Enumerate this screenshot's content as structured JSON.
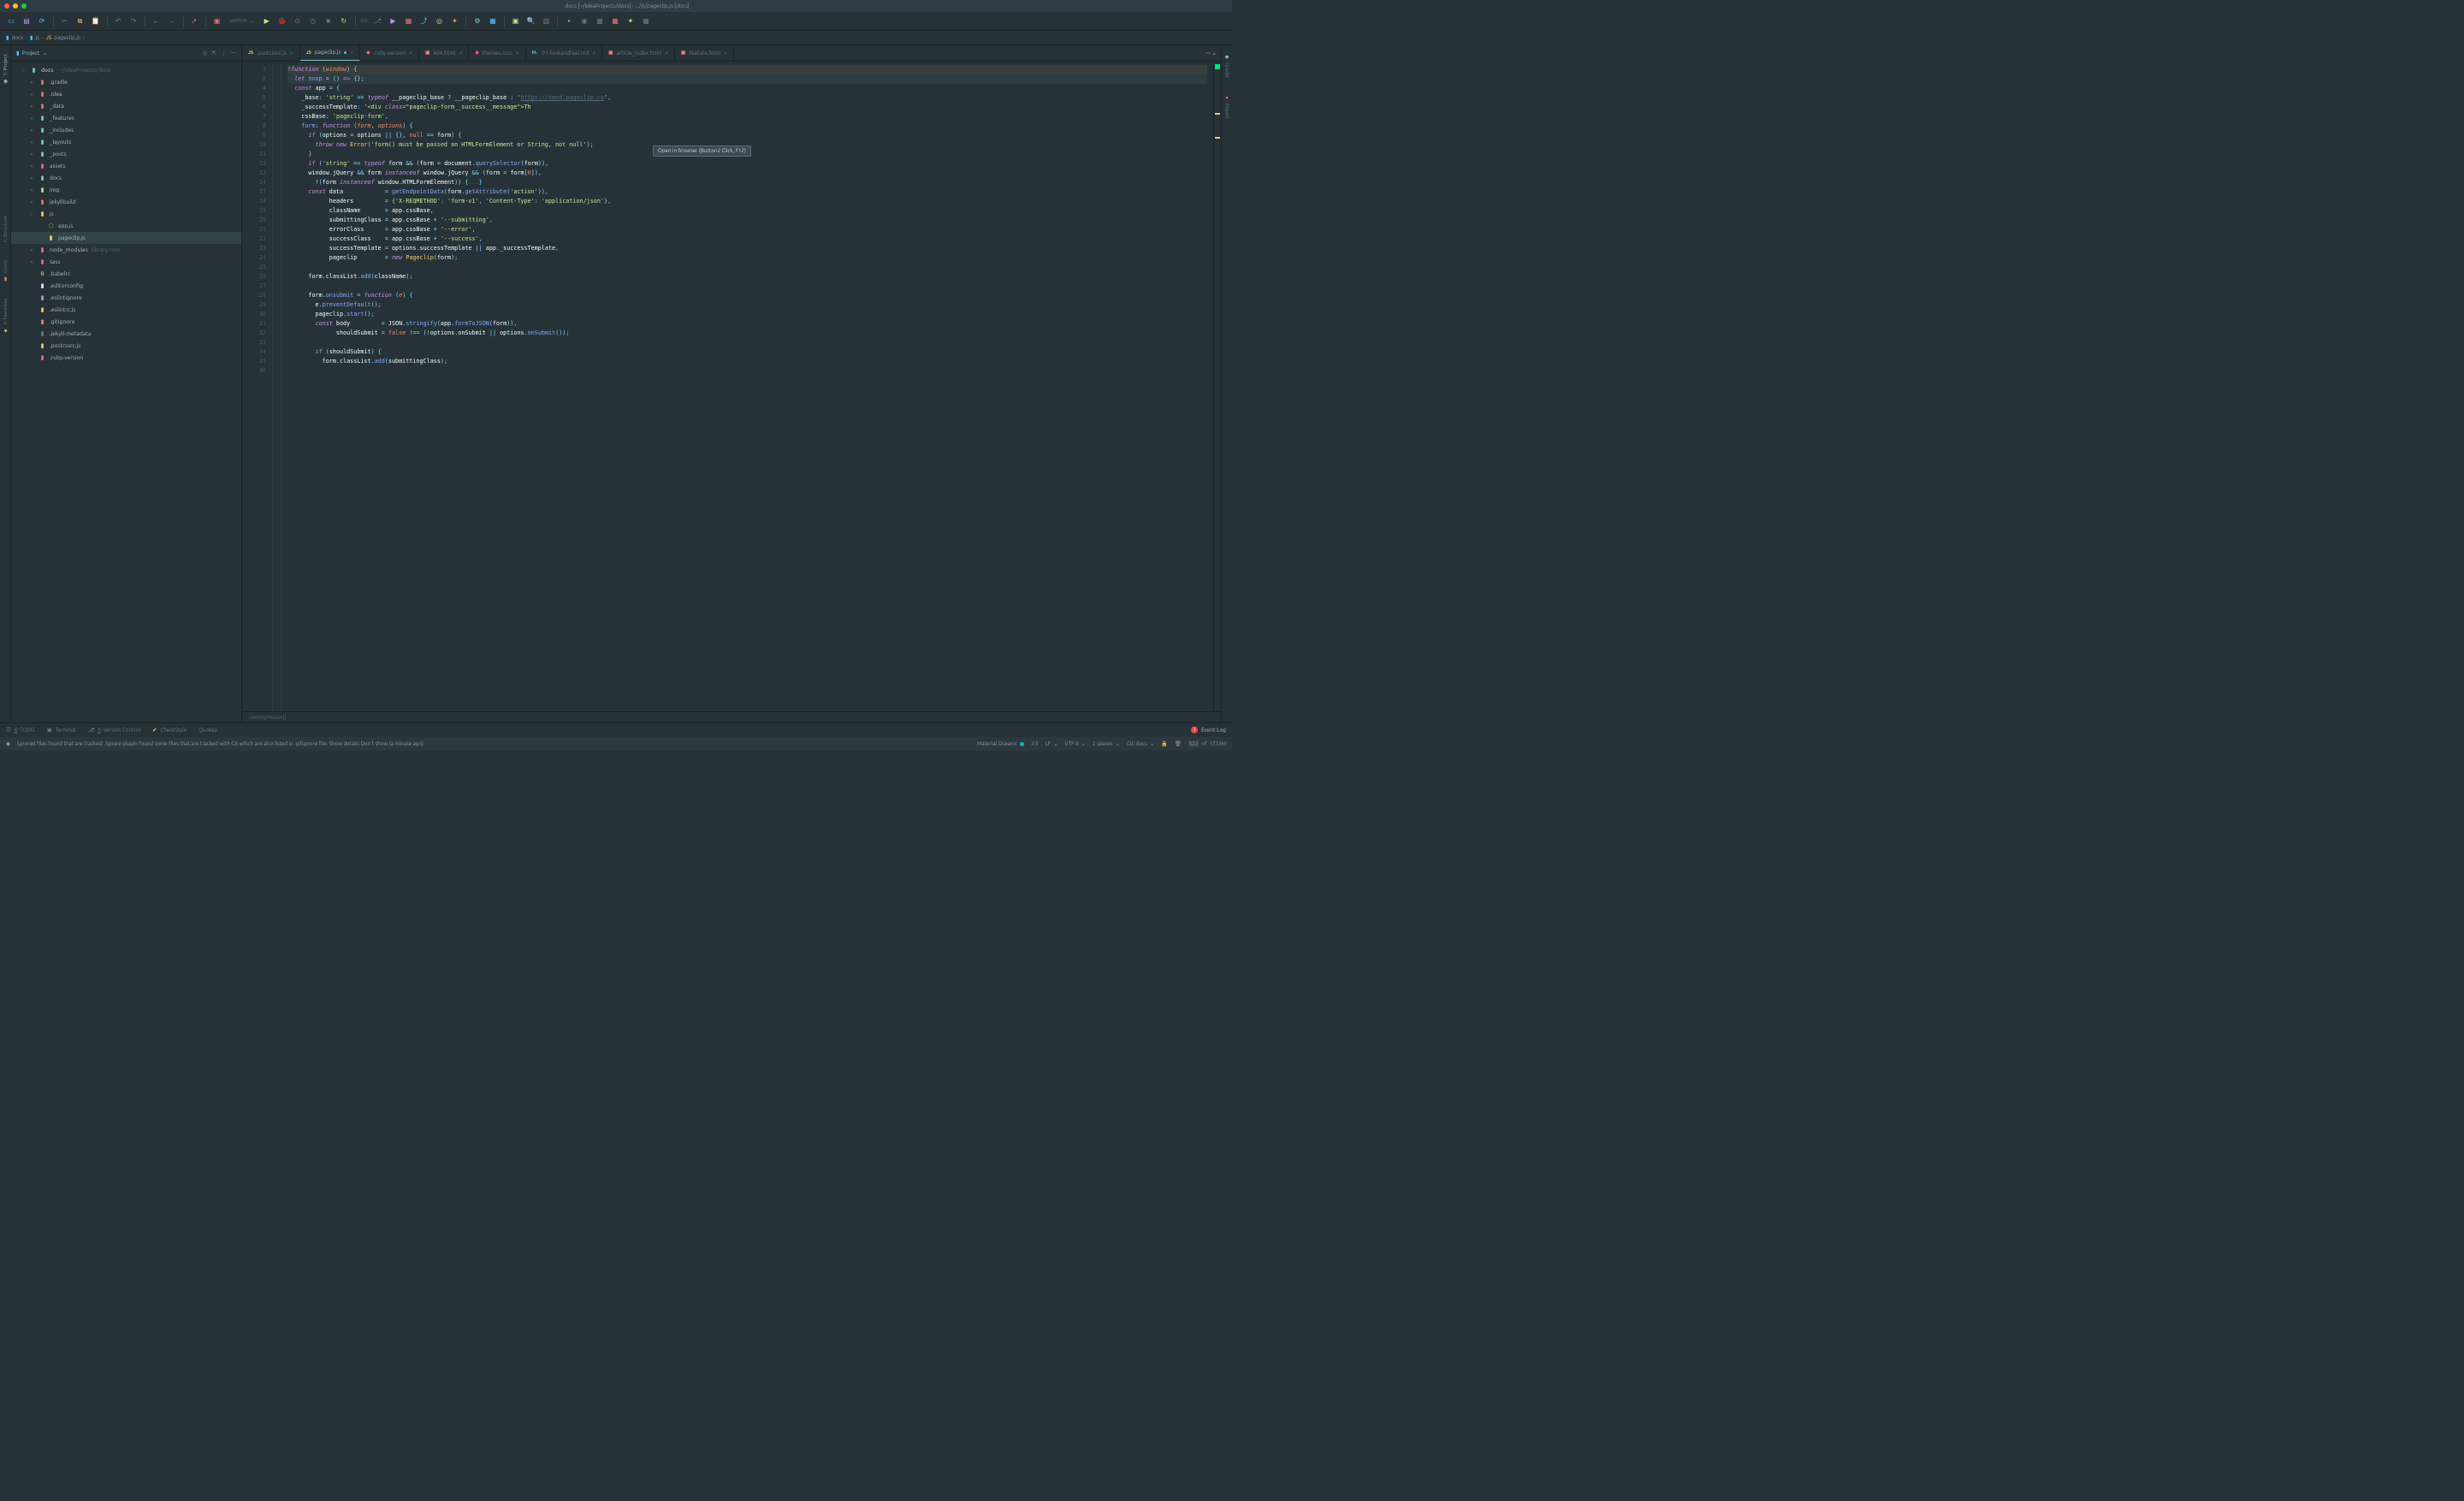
{
  "title": "docs [~/IdeaProjects/docs] - .../js/pageclip.js [docs]",
  "toolbar": {
    "watch_label": "WATCH",
    "git_label": "Git:"
  },
  "breadcrumbs": [
    {
      "icon": "folder",
      "label": "docs"
    },
    {
      "icon": "folder",
      "label": "js"
    },
    {
      "icon": "js",
      "label": "pageclip.js"
    }
  ],
  "sidebar": {
    "view_label": "Project",
    "root": {
      "label": "docs",
      "path": "~/IdeaProjects/docs"
    },
    "items": [
      {
        "depth": 1,
        "kind": "folder",
        "label": ".gradle",
        "cls": "folder-special",
        "expandable": true
      },
      {
        "depth": 1,
        "kind": "folder",
        "label": ".idea",
        "cls": "folder-special",
        "expandable": true
      },
      {
        "depth": 1,
        "kind": "folder",
        "label": "_data",
        "cls": "folder-special",
        "expandable": true
      },
      {
        "depth": 1,
        "kind": "folder",
        "label": "_features",
        "cls": "folder",
        "expandable": true
      },
      {
        "depth": 1,
        "kind": "folder",
        "label": "_includes",
        "cls": "folder",
        "expandable": true
      },
      {
        "depth": 1,
        "kind": "folder",
        "label": "_layouts",
        "cls": "folder",
        "expandable": true
      },
      {
        "depth": 1,
        "kind": "folder",
        "label": "_posts",
        "cls": "folder",
        "expandable": true
      },
      {
        "depth": 1,
        "kind": "folder",
        "label": "assets",
        "cls": "folder-special",
        "expandable": true
      },
      {
        "depth": 1,
        "kind": "folder",
        "label": "docs",
        "cls": "folder",
        "expandable": true
      },
      {
        "depth": 1,
        "kind": "folder",
        "label": "img",
        "cls": "folder-green",
        "expandable": true
      },
      {
        "depth": 1,
        "kind": "folder",
        "label": "jekyllbuild",
        "cls": "folder-special",
        "expandable": true,
        "selected": false
      },
      {
        "depth": 1,
        "kind": "folder",
        "label": "js",
        "cls": "fic-js",
        "expandable": true,
        "open": true
      },
      {
        "depth": 2,
        "kind": "file",
        "label": "app.js",
        "cls": "fic-node"
      },
      {
        "depth": 2,
        "kind": "file",
        "label": "pageclip.js",
        "cls": "fic-js",
        "selected": true
      },
      {
        "depth": 1,
        "kind": "folder",
        "label": "node_modules",
        "cls": "folder-nm",
        "suffix": "library root",
        "expandable": true
      },
      {
        "depth": 1,
        "kind": "folder",
        "label": "sass",
        "cls": "fic-sass",
        "expandable": true
      },
      {
        "depth": 1,
        "kind": "file",
        "label": ".babelrc",
        "cls": "fic-babel"
      },
      {
        "depth": 1,
        "kind": "file",
        "label": ".editorconfig",
        "cls": "fic-editor"
      },
      {
        "depth": 1,
        "kind": "file",
        "label": ".eslintignore",
        "cls": "fic-eslint"
      },
      {
        "depth": 1,
        "kind": "file",
        "label": ".eslintrc.js",
        "cls": "fic-js"
      },
      {
        "depth": 1,
        "kind": "file",
        "label": ".gitignore",
        "cls": "fic-git"
      },
      {
        "depth": 1,
        "kind": "file",
        "label": ".jekyll-metadata",
        "cls": "fic-generic"
      },
      {
        "depth": 1,
        "kind": "file",
        "label": ".postcssrc.js",
        "cls": "fic-js"
      },
      {
        "depth": 1,
        "kind": "file",
        "label": ".ruby-version",
        "cls": "fic-ruby"
      }
    ]
  },
  "left_vtabs": [
    {
      "label": "1: Project",
      "active": true
    },
    {
      "label": "7: Structure"
    },
    {
      "label": "Grunt"
    },
    {
      "label": "2: Favorites"
    }
  ],
  "right_vtabs": [
    {
      "label": "Gradle"
    },
    {
      "label": "Maven"
    }
  ],
  "tabs": [
    {
      "icon": "js",
      "label": ".postcssrc.js",
      "active": false
    },
    {
      "icon": "js",
      "label": "pageclip.js",
      "active": true,
      "modified": true
    },
    {
      "icon": "ruby",
      "label": ".ruby-version"
    },
    {
      "icon": "html",
      "label": "404.html"
    },
    {
      "icon": "sass",
      "label": "themes.scss"
    },
    {
      "icon": "md",
      "label": "01-lookandfeel.md"
    },
    {
      "icon": "html",
      "label": "article_index.html"
    },
    {
      "icon": "html",
      "label": "feature.html"
    }
  ],
  "tabs_more": "⋯",
  "code": {
    "lines_start": 1,
    "tooltip": "Open in browser (Button2 Click, F12)",
    "anon_crumb": "<anonymous>()",
    "url": "https://send.pageclip.co"
  },
  "bottom_tabs": [
    {
      "icon": "☰",
      "label": "6: TODO",
      "under": "6"
    },
    {
      "icon": "▣",
      "label": "Terminal"
    },
    {
      "icon": "⎇",
      "label": "9: Version Control",
      "under": "9"
    },
    {
      "icon": "✔",
      "label": "CheckStyle"
    },
    {
      "icon": "",
      "label": "Quokka"
    }
  ],
  "event_log": {
    "count": "3",
    "label": "Event Log"
  },
  "status": {
    "msg_prefix": "Ignored files found that are tracked: .ignore plugin found some files that are tracked with Git which are also listed in .gitignore file. ",
    "msg_link1": "Show details",
    "msg_gap": " ",
    "msg_link2": "Don't show",
    "msg_suffix": " (a minute ago)",
    "theme": "Material Oceanic",
    "pos": "3:5",
    "sep": "LF",
    "enc": "UTF-8",
    "indent": "2 spaces",
    "git": "Git: docs",
    "mem_cur": "522",
    "mem_total": "1733M",
    "mem_of": " of "
  }
}
